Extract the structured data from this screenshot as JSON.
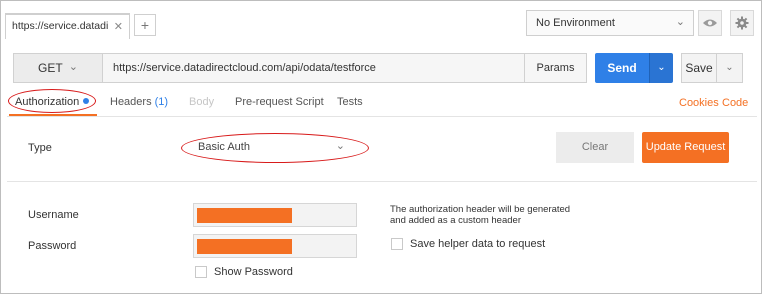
{
  "tabs": {
    "request_tab_title": "https://service.datadi",
    "close_glyph": "✕",
    "new_tab_glyph": "+"
  },
  "environment": {
    "selected": "No Environment",
    "eye_icon": "eye-icon",
    "settings_icon": "gear-icon"
  },
  "request": {
    "method": "GET",
    "url": "https://service.datadirectcloud.com/api/odata/testforce",
    "params_label": "Params",
    "send_label": "Send",
    "save_label": "Save"
  },
  "subtabs": {
    "authorization": "Authorization",
    "headers": "Headers",
    "headers_count": "(1)",
    "body": "Body",
    "prerequest": "Pre-request Script",
    "tests": "Tests",
    "cookies": "Cookies",
    "code": "Code"
  },
  "auth": {
    "type_label": "Type",
    "type_value": "Basic Auth",
    "clear_label": "Clear",
    "update_label": "Update Request",
    "username_label": "Username",
    "password_label": "Password",
    "show_password_label": "Show Password",
    "help_text": "The authorization header will be generated and added as a custom header",
    "save_helper_label": "Save helper data to request"
  },
  "colors": {
    "accent_blue": "#2f80e7",
    "accent_orange": "#f47023",
    "annotation_red": "#d81b1b"
  }
}
